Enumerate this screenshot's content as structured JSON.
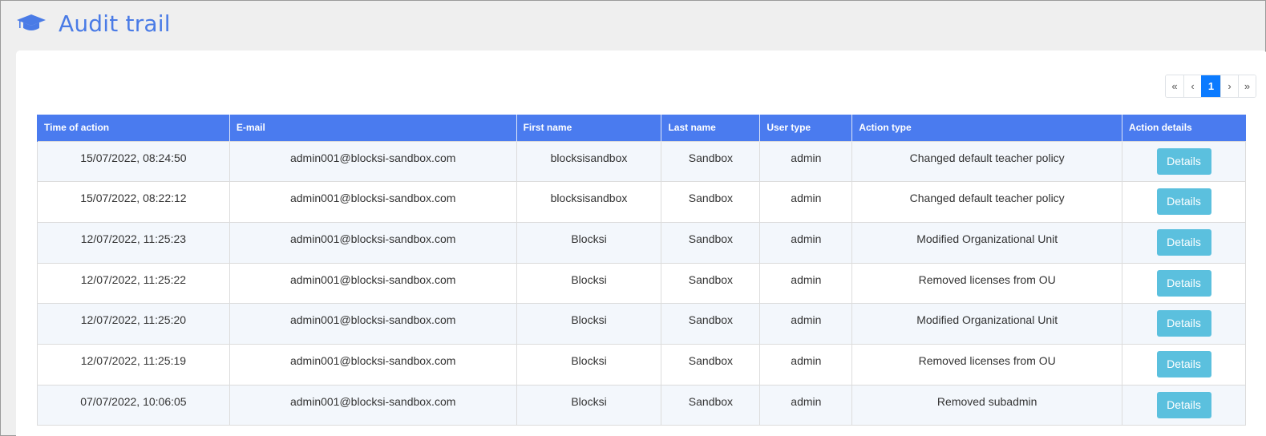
{
  "header": {
    "title": "Audit trail",
    "icon": "graduation-cap-icon"
  },
  "pagination": {
    "first": "«",
    "prev": "‹",
    "current": "1",
    "next": "›",
    "last": "»"
  },
  "table": {
    "columns": [
      "Time of action",
      "E-mail",
      "First name",
      "Last name",
      "User type",
      "Action type",
      "Action details"
    ],
    "details_label": "Details",
    "rows": [
      [
        "15/07/2022, 08:24:50",
        "admin001@blocksi-sandbox.com",
        "blocksisandbox",
        "Sandbox",
        "admin",
        "Changed default teacher policy"
      ],
      [
        "15/07/2022, 08:22:12",
        "admin001@blocksi-sandbox.com",
        "blocksisandbox",
        "Sandbox",
        "admin",
        "Changed default teacher policy"
      ],
      [
        "12/07/2022, 11:25:23",
        "admin001@blocksi-sandbox.com",
        "Blocksi",
        "Sandbox",
        "admin",
        "Modified Organizational Unit"
      ],
      [
        "12/07/2022, 11:25:22",
        "admin001@blocksi-sandbox.com",
        "Blocksi",
        "Sandbox",
        "admin",
        "Removed licenses from OU"
      ],
      [
        "12/07/2022, 11:25:20",
        "admin001@blocksi-sandbox.com",
        "Blocksi",
        "Sandbox",
        "admin",
        "Modified Organizational Unit"
      ],
      [
        "12/07/2022, 11:25:19",
        "admin001@blocksi-sandbox.com",
        "Blocksi",
        "Sandbox",
        "admin",
        "Removed licenses from OU"
      ],
      [
        "07/07/2022, 10:06:05",
        "admin001@blocksi-sandbox.com",
        "Blocksi",
        "Sandbox",
        "admin",
        "Removed subadmin"
      ]
    ]
  },
  "colors": {
    "accent": "#4a7bef",
    "title": "#4a7be6",
    "details_button": "#5bc0de",
    "page_active": "#0b7bff"
  }
}
